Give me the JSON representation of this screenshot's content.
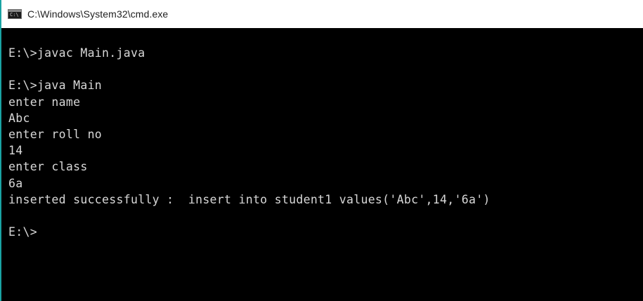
{
  "window": {
    "title": "C:\\Windows\\System32\\cmd.exe",
    "icon": "cmd-console-icon"
  },
  "console": {
    "lines": [
      "E:\\>javac Main.java",
      "",
      "E:\\>java Main",
      "enter name",
      "Abc",
      "enter roll no",
      "14",
      "enter class",
      "6a",
      "inserted successfully :  insert into student1 values('Abc',14,'6a')",
      "",
      "E:\\>"
    ]
  }
}
